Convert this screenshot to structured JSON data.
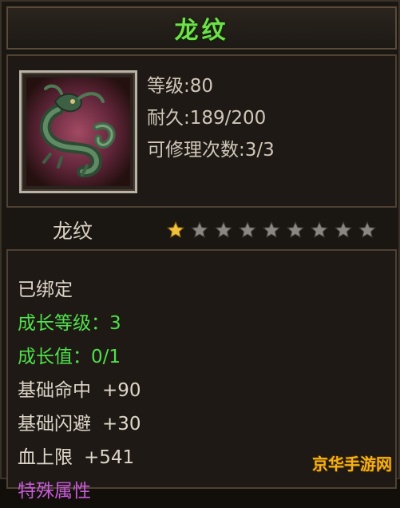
{
  "title": "龙纹",
  "stats": {
    "level": "等级:80",
    "durability": "耐久:189/200",
    "repair_count": "可修理次数:3/3"
  },
  "item_name": "龙纹",
  "star_rating": {
    "filled": 1,
    "total": 9,
    "filled_color": "#f0c23a",
    "empty_color": "#8a8680"
  },
  "attributes": [
    {
      "label": "已绑定",
      "value": "",
      "style": "normal"
    },
    {
      "label": "成长等级：",
      "value": "3",
      "style": "green"
    },
    {
      "label": "成长值：",
      "value": "0/1",
      "style": "green"
    },
    {
      "label": "基础命中",
      "value": "+90",
      "style": "normal"
    },
    {
      "label": "基础闪避",
      "value": "+30",
      "style": "normal"
    },
    {
      "label": "血上限",
      "value": "+541",
      "style": "normal"
    },
    {
      "label": "特殊属性",
      "value": "",
      "style": "purple"
    }
  ],
  "watermark": "京华手游网",
  "colors": {
    "title": "#6fe04a",
    "green_attr": "#4fe04a",
    "text": "#ddd6c9",
    "purple_attr": "#c85bd8"
  },
  "icon": "dragon-emblem-icon"
}
